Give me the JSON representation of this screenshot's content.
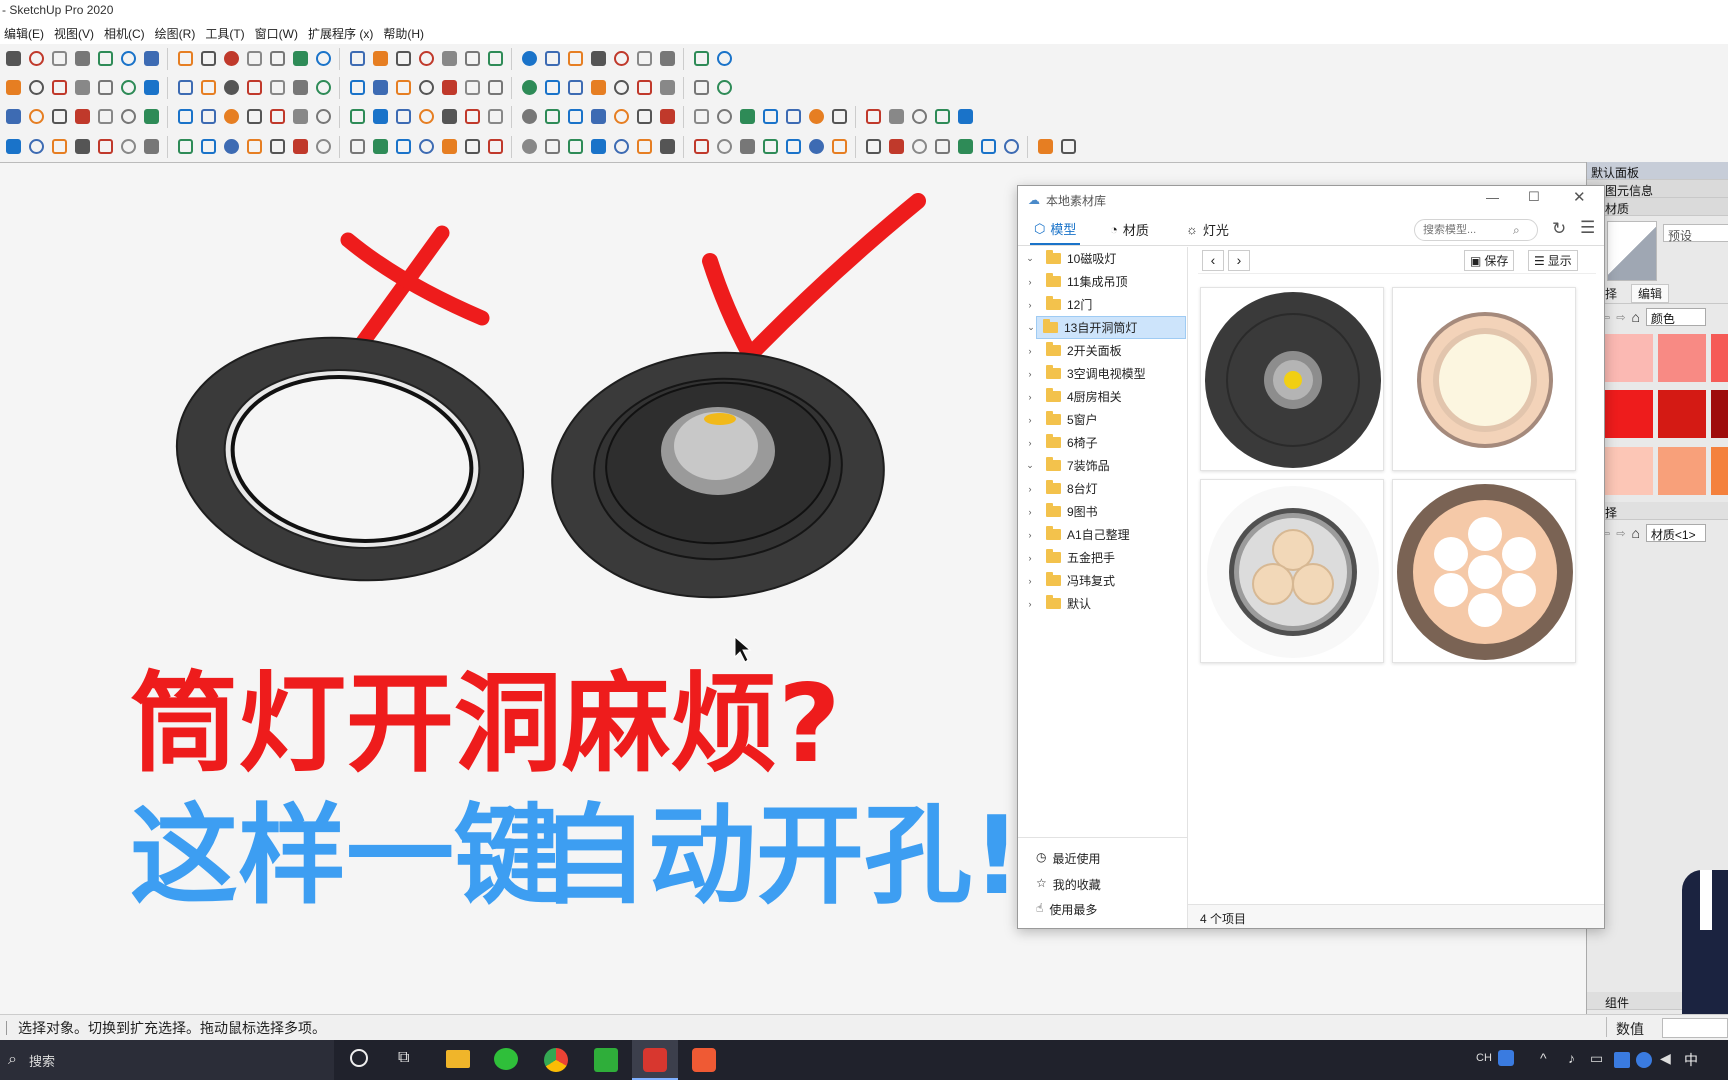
{
  "app": {
    "title": "- SketchUp Pro 2020"
  },
  "menu": [
    {
      "label": "编辑(E)"
    },
    {
      "label": "视图(V)"
    },
    {
      "label": "相机(C)"
    },
    {
      "label": "绘图(R)"
    },
    {
      "label": "工具(T)"
    },
    {
      "label": "窗口(W)"
    },
    {
      "label": "扩展程序 (x)"
    },
    {
      "label": "帮助(H)"
    }
  ],
  "viewport": {
    "headline1": "筒灯开洞麻烦?",
    "headline2a": "这样一键",
    "headline2b": "自动开孔!",
    "colors": {
      "red": "#ee1c1c",
      "blue": "#3d9ef2",
      "ring": "#3a3a3a"
    }
  },
  "dialog": {
    "title": "本地素材库",
    "tabs": [
      {
        "label": "模型",
        "active": true
      },
      {
        "label": "材质"
      },
      {
        "label": "灯光"
      }
    ],
    "search_placeholder": "搜索模型...",
    "save_label": "保存",
    "display_label": "显示",
    "tree": [
      {
        "label": "10磁吸灯",
        "expanded": true
      },
      {
        "label": "11集成吊顶"
      },
      {
        "label": "12门"
      },
      {
        "label": "13自开洞筒灯",
        "selected": true,
        "expanded": true
      },
      {
        "label": "2开关面板"
      },
      {
        "label": "3空调电视模型"
      },
      {
        "label": "4厨房相关"
      },
      {
        "label": "5窗户"
      },
      {
        "label": "6椅子"
      },
      {
        "label": "7装饰品",
        "expanded": true
      },
      {
        "label": "8台灯"
      },
      {
        "label": "9图书"
      },
      {
        "label": "A1自己整理"
      },
      {
        "label": "五金把手"
      },
      {
        "label": "冯玮复式"
      },
      {
        "label": "默认"
      }
    ],
    "bottom_links": [
      {
        "label": "最近使用"
      },
      {
        "label": "我的收藏"
      },
      {
        "label": "使用最多"
      }
    ],
    "status": "4 个项目"
  },
  "rightpanel": {
    "tray_title": "默认面板",
    "entity_info": "图元信息",
    "materials": "材质",
    "preset_label": "预设",
    "select_tab": "择",
    "edit_tab": "编辑",
    "color_dropdown": "颜色",
    "select_tab2": "择",
    "material_name": "材质<1>",
    "components": "组件",
    "value_label": "数值",
    "swatches": [
      "#fbb9b3",
      "#f88a84",
      "#f55b57",
      "#ee1c1c",
      "#d41a14",
      "#9e0c0c",
      "#fcc6b6",
      "#f8a07a",
      "#f4813d"
    ]
  },
  "status": {
    "hint": "选择对象。切换到扩充选择。拖动鼠标选择多项。"
  },
  "taskbar": {
    "search": "搜索",
    "ime1": "CH",
    "ime2": "中"
  }
}
